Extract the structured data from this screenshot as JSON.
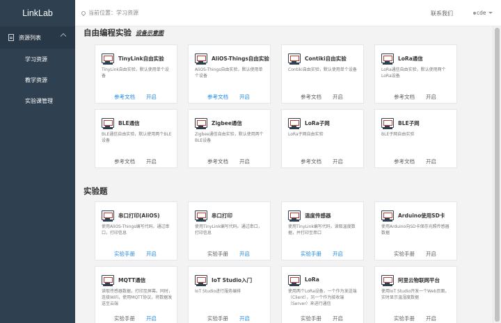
{
  "app": {
    "brand": "LinkLab"
  },
  "sidebar": {
    "section": "资源列表",
    "items": [
      {
        "label": "学习资源"
      },
      {
        "label": "教学资源"
      },
      {
        "label": "实验课管理"
      }
    ]
  },
  "topbar": {
    "breadcrumb": "当前位置：学习资源",
    "contact": "联系我们",
    "user": "cde"
  },
  "section1": {
    "title": "自由编程实验",
    "link": "设备示意图",
    "cards": [
      {
        "title": "TinyLink自由实验",
        "desc": "TinyLink自由实验，默认使用单个设备",
        "btn1": "参考文档",
        "btn2": "开启",
        "btn1_active": true,
        "btn2_active": true
      },
      {
        "title": "AliOS-Things自由实验",
        "desc": "AliOS-Things自由实验，默认使用单个设备",
        "btn1": "参考文档",
        "btn2": "开启",
        "btn1_active": true,
        "btn2_active": true
      },
      {
        "title": "Contiki自由实验",
        "desc": "Contiki自由实验，默认使用单个设备",
        "btn1": "参考文档",
        "btn2": "开启",
        "btn1_active": false,
        "btn2_active": false
      },
      {
        "title": "LoRa通信",
        "desc": "LoRa通信自由实验，默认使用两个LoRa设备",
        "btn1": "参考文档",
        "btn2": "开启",
        "btn1_active": false,
        "btn2_active": false
      },
      {
        "title": "BLE通信",
        "desc": "BLE通信自由实验，默认使用两个BLE设备",
        "btn1": "参考文档",
        "btn2": "开启",
        "btn1_active": false,
        "btn2_active": false
      },
      {
        "title": "Zigbee通信",
        "desc": "Zigbee通信自由实验，默认使用两个BLE设备",
        "btn1": "参考文档",
        "btn2": "开启",
        "btn1_active": false,
        "btn2_active": false
      },
      {
        "title": "LoRa子网",
        "desc": "LoRa子网自由实验",
        "btn1": "参考文档",
        "btn2": "开启",
        "btn1_active": false,
        "btn2_active": false
      },
      {
        "title": "BLE子网",
        "desc": "BLE子网自由实验",
        "btn1": "参考文档",
        "btn2": "开启",
        "btn1_active": false,
        "btn2_active": false
      }
    ]
  },
  "section2": {
    "title": "实验题",
    "cards": [
      {
        "title": "串口打印(AliOS)",
        "desc": "使用AliOS-Things编写代码。通过串口，打印信息",
        "btn1": "实验手册",
        "btn2": "开启",
        "btn1_active": true,
        "btn2_active": true
      },
      {
        "title": "串口打印",
        "desc": "使用TinyLink编写代码。通过串口，打印信息",
        "btn1": "实验手册",
        "btn2": "开启",
        "btn1_active": false,
        "btn2_active": true
      },
      {
        "title": "温度传感器",
        "desc": "使用TinyLink编写代码，读取温度数据，并打印至串口",
        "btn1": "实验手册",
        "btn2": "开启",
        "btn1_active": true,
        "btn2_active": true
      },
      {
        "title": "Arduino使用SD卡",
        "desc": "使用Arduino向SD卡保存光照传感器数据",
        "btn1": "实验手册",
        "btn2": "开启",
        "btn1_active": false,
        "btn2_active": false
      },
      {
        "title": "MQTT通信",
        "desc": "读取传感器数据，打印至屏幕。同时，连接WiFi，使用MQTT协议，将数据发送至云端",
        "btn1": "实验手册",
        "btn2": "开启",
        "btn1_active": false,
        "btn2_active": true
      },
      {
        "title": "IoT Studio入门",
        "desc": "IoT Studio进行服务编排",
        "btn1": "实验手册",
        "btn2": "开启",
        "btn1_active": false,
        "btn2_active": true
      },
      {
        "title": "LoRa",
        "desc": "使用两个LoRa设备，一个作为发送端（Client），另一个作为接收端（Server）来进行通信",
        "btn1": "实验手册",
        "btn2": "开启",
        "btn1_active": false,
        "btn2_active": false
      },
      {
        "title": "阿里云物联网平台",
        "desc": "使用IoT Studio开发一个Web页面，实时显示温湿度数据",
        "btn1": "实验手册",
        "btn2": "开启",
        "btn1_active": false,
        "btn2_active": false
      }
    ]
  }
}
